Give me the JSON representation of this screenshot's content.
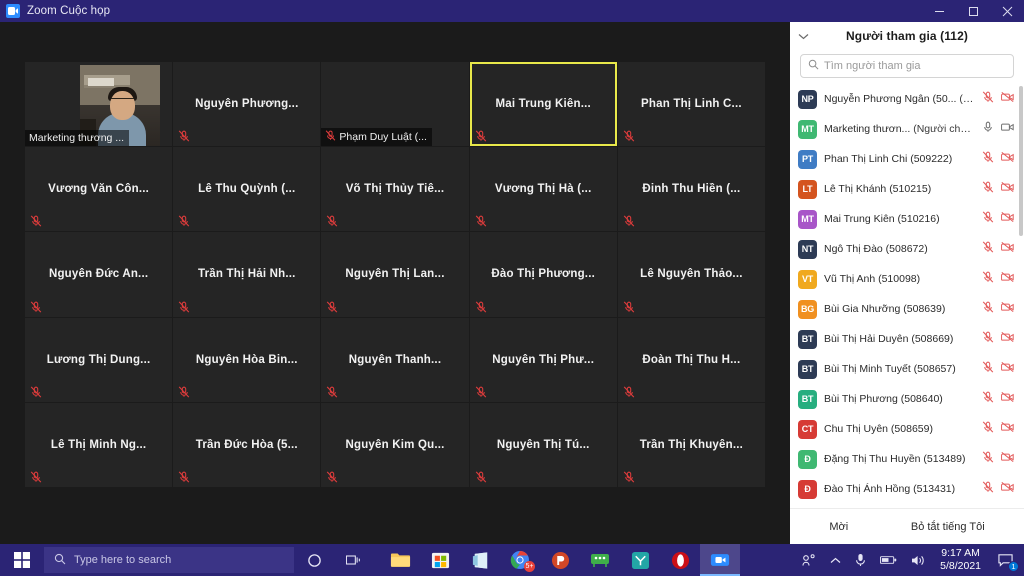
{
  "window": {
    "title": "Zoom Cuộc họp",
    "icon": "zoom-icon",
    "minimize_label": "—",
    "maximize_label": "❐",
    "close_label": "✕"
  },
  "stage": {
    "tiles": [
      {
        "name": "Marketing thương ...",
        "display": "corner",
        "video": true,
        "muted": false,
        "active": false
      },
      {
        "name": "Nguyễn Phương...",
        "display": "center",
        "video": false,
        "muted": true,
        "active": false
      },
      {
        "name": "Phạm Duy Luật (...",
        "display": "corner",
        "video": false,
        "muted": true,
        "active": false
      },
      {
        "name": "Mai Trung Kiên...",
        "display": "center",
        "video": false,
        "muted": true,
        "active": true
      },
      {
        "name": "Phan Thị Linh C...",
        "display": "center",
        "video": false,
        "muted": true,
        "active": false
      },
      {
        "name": "Vương Văn Côn...",
        "display": "center",
        "video": false,
        "muted": true,
        "active": false
      },
      {
        "name": "Lê Thu Quỳnh (...",
        "display": "center",
        "video": false,
        "muted": true,
        "active": false
      },
      {
        "name": "Võ Thị Thủy Tiê...",
        "display": "center",
        "video": false,
        "muted": true,
        "active": false
      },
      {
        "name": "Vương Thị Hà (...",
        "display": "center",
        "video": false,
        "muted": true,
        "active": false
      },
      {
        "name": "Đinh Thu Hiền (...",
        "display": "center",
        "video": false,
        "muted": true,
        "active": false
      },
      {
        "name": "Nguyễn Đức An...",
        "display": "center",
        "video": false,
        "muted": true,
        "active": false
      },
      {
        "name": "Trần Thị Hải Nh...",
        "display": "center",
        "video": false,
        "muted": true,
        "active": false
      },
      {
        "name": "Nguyễn Thị Lan...",
        "display": "center",
        "video": false,
        "muted": true,
        "active": false
      },
      {
        "name": "Đào Thị Phương...",
        "display": "center",
        "video": false,
        "muted": true,
        "active": false
      },
      {
        "name": "Lê Nguyễn Thảo...",
        "display": "center",
        "video": false,
        "muted": true,
        "active": false
      },
      {
        "name": "Lương Thị Dung...",
        "display": "center",
        "video": false,
        "muted": true,
        "active": false
      },
      {
        "name": "Nguyễn Hòa Bin...",
        "display": "center",
        "video": false,
        "muted": true,
        "active": false
      },
      {
        "name": "Nguyễn Thanh...",
        "display": "center",
        "video": false,
        "muted": true,
        "active": false
      },
      {
        "name": "Nguyễn Thị Phư...",
        "display": "center",
        "video": false,
        "muted": true,
        "active": false
      },
      {
        "name": "Đoàn Thị Thu H...",
        "display": "center",
        "video": false,
        "muted": true,
        "active": false
      },
      {
        "name": "Lê Thị Minh Ng...",
        "display": "center",
        "video": false,
        "muted": true,
        "active": false
      },
      {
        "name": "Trần Đức Hòa (5...",
        "display": "center",
        "video": false,
        "muted": true,
        "active": false
      },
      {
        "name": "Nguyễn Kim Qu...",
        "display": "center",
        "video": false,
        "muted": true,
        "active": false
      },
      {
        "name": "Nguyễn Thị Tú...",
        "display": "center",
        "video": false,
        "muted": true,
        "active": false
      },
      {
        "name": "Trần Thị Khuyên...",
        "display": "center",
        "video": false,
        "muted": true,
        "active": false
      }
    ],
    "active_speaker_color": "#e8e84a"
  },
  "panel": {
    "title": "Người tham gia (112)",
    "collapse_icon": "chevron-down-icon",
    "search": {
      "placeholder": "Tìm người tham gia",
      "value": "",
      "icon": "search-icon"
    },
    "participants": [
      {
        "initials": "NP",
        "color": "#2d3b55",
        "name": "Nguyễn Phương Ngân (50...",
        "tag": "(Tôi)",
        "mic": "muted",
        "cam": "off"
      },
      {
        "initials": "MT",
        "color": "#3fb872",
        "name": "Marketing thươn...",
        "tag": "(Người chủ trì)",
        "mic": "on",
        "cam": "on"
      },
      {
        "initials": "PT",
        "color": "#3f7cc4",
        "name": "Phan Thị Linh Chi (509222)",
        "tag": "",
        "mic": "muted",
        "cam": "off"
      },
      {
        "initials": "LT",
        "color": "#d4541f",
        "name": "Lê Thị Khánh (510215)",
        "tag": "",
        "mic": "muted",
        "cam": "off"
      },
      {
        "initials": "MT",
        "color": "#a855c8",
        "name": "Mai Trung Kiên (510216)",
        "tag": "",
        "mic": "muted",
        "cam": "off"
      },
      {
        "initials": "NT",
        "color": "#2d3b55",
        "name": "Ngô Thị Đào (508672)",
        "tag": "",
        "mic": "muted",
        "cam": "off"
      },
      {
        "initials": "VT",
        "color": "#f0a91e",
        "name": "Vũ Thị Anh (510098)",
        "tag": "",
        "mic": "muted",
        "cam": "off"
      },
      {
        "initials": "BG",
        "color": "#f09020",
        "name": "Bùi Gia Nhưỡng (508639)",
        "tag": "",
        "mic": "muted",
        "cam": "off"
      },
      {
        "initials": "BT",
        "color": "#2d3b55",
        "name": "Bùi Thị Hải Duyên (508669)",
        "tag": "",
        "mic": "muted",
        "cam": "off"
      },
      {
        "initials": "BT",
        "color": "#2d3b55",
        "name": "Bùi Thị Minh Tuyết (508657)",
        "tag": "",
        "mic": "muted",
        "cam": "off"
      },
      {
        "initials": "BT",
        "color": "#27ae7f",
        "name": "Bùi Thị Phương (508640)",
        "tag": "",
        "mic": "muted",
        "cam": "off"
      },
      {
        "initials": "CT",
        "color": "#d63b35",
        "name": "Chu Thị Uyên (508659)",
        "tag": "",
        "mic": "muted",
        "cam": "off"
      },
      {
        "initials": "Đ",
        "color": "#3fb872",
        "name": "Đặng Thị Thu Huyền (513489)",
        "tag": "",
        "mic": "muted",
        "cam": "off"
      },
      {
        "initials": "Đ",
        "color": "#d63b35",
        "name": "Đào Thị Ánh Hồng (513431)",
        "tag": "",
        "mic": "muted",
        "cam": "off"
      }
    ],
    "footer": {
      "invite_label": "Mời",
      "unmute_label": "Bỏ tắt tiếng Tôi"
    }
  },
  "taskbar": {
    "start_icon": "windows-start-icon",
    "search_placeholder": "Type here to search",
    "search_icon": "search-icon",
    "cortana_icon": "cortana-icon",
    "taskview_icon": "task-view-icon",
    "apps": [
      {
        "name": "file-explorer-icon",
        "badge": ""
      },
      {
        "name": "microsoft-store-icon",
        "badge": ""
      },
      {
        "name": "onenote-icon",
        "badge": ""
      },
      {
        "name": "browser-icon",
        "badge": "5+"
      },
      {
        "name": "powerpoint-icon",
        "badge": ""
      },
      {
        "name": "green-app-icon",
        "badge": ""
      },
      {
        "name": "teal-app-icon",
        "badge": ""
      },
      {
        "name": "opera-icon",
        "badge": ""
      },
      {
        "name": "zoom-app-icon",
        "badge": ""
      }
    ],
    "tray": {
      "people_icon": "people-share-icon",
      "chevron_icon": "chevron-up-icon",
      "mic_icon": "microphone-icon",
      "battery_icon": "battery-icon",
      "volume_icon": "volume-icon",
      "time": "9:17 AM",
      "date": "5/8/2021",
      "notification_icon": "notification-icon",
      "notification_count": "1"
    }
  }
}
